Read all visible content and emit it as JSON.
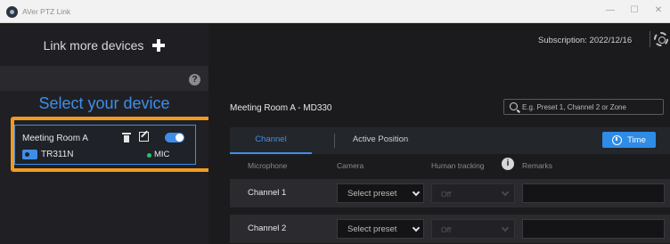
{
  "window": {
    "title": "AVer PTZ Link",
    "minimize": "—",
    "maximize": "☐",
    "close": "✕"
  },
  "sidebar": {
    "link_more_label": "Link more devices",
    "help": "?",
    "select_title": "Select your device",
    "device": {
      "name": "Meeting Room A",
      "model": "TR311N",
      "mic_label": "MIC",
      "enabled": true
    }
  },
  "header": {
    "subscription": "Subscription: 2022/12/16"
  },
  "main": {
    "room_title": "Meeting Room A - MD330",
    "search_placeholder": "E.g. Preset 1, Channel 2 or Zone",
    "tabs": [
      {
        "label": "Channel",
        "active": true
      },
      {
        "label": "Active Position",
        "active": false
      }
    ],
    "time_button": "Time",
    "columns": {
      "microphone": "Microphone",
      "camera": "Camera",
      "human_tracking": "Human tracking",
      "remarks": "Remarks"
    },
    "info": "i",
    "rows": [
      {
        "channel": "Channel 1",
        "camera": "Select preset",
        "tracking": "Off",
        "remarks": ""
      },
      {
        "channel": "Channel 2",
        "camera": "Select preset",
        "tracking": "Off",
        "remarks": ""
      }
    ]
  },
  "colors": {
    "accent": "#3e8ee8",
    "highlight": "#f39a1f",
    "mic_status": "#26c46a"
  }
}
